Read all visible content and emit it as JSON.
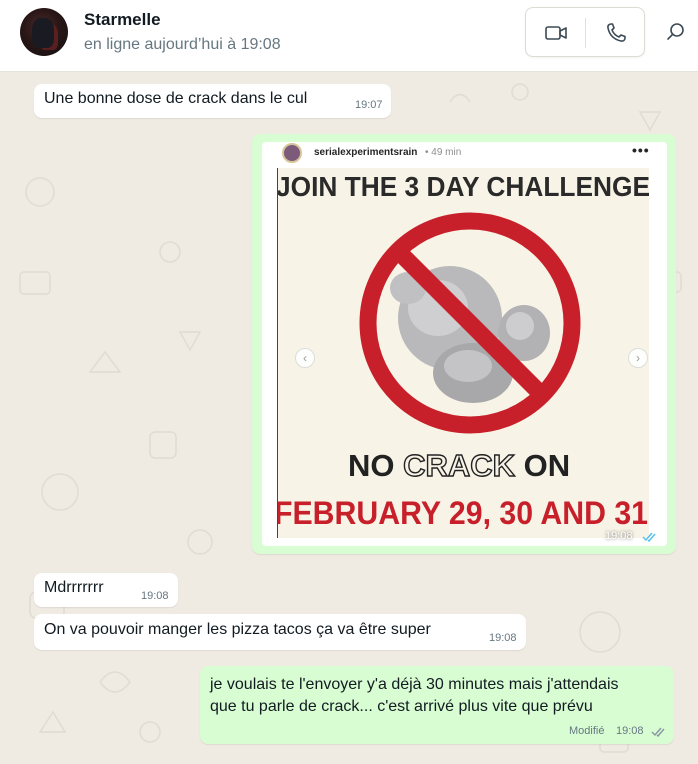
{
  "header": {
    "contact_name": "Starmelle",
    "status": "en ligne aujourd’hui à 19:08",
    "buttons": [
      "video-call",
      "voice-call",
      "search"
    ]
  },
  "messages": [
    {
      "direction": "in",
      "text": "Une bonne dose de crack dans le cul",
      "time": "19:07"
    },
    {
      "direction": "out",
      "type": "image",
      "time": "19:08",
      "read": true,
      "post": {
        "username": "serialexperimentsrain",
        "age": "• 49 min",
        "more": "•••",
        "headline": "JOIN THE 3 DAY CHALLENGE",
        "line1_prefix": "NO ",
        "line1_highlight": "CRACK",
        "line1_suffix": " ON",
        "line2": "FEBRUARY 29, 30 AND 31"
      }
    },
    {
      "direction": "in",
      "text": "Mdrrrrrrr",
      "time": "19:08"
    },
    {
      "direction": "in",
      "text": "On va pouvoir manger les pizza tacos ça va être super",
      "time": "19:08"
    },
    {
      "direction": "out",
      "lines": [
        "je voulais te l'envoyer y'a déjà 30 minutes mais j'attendais",
        "que tu parle de crack... c'est arrivé plus vite que prévu"
      ],
      "edited_label": "Modifié",
      "time": "19:08",
      "read": true
    }
  ],
  "colors": {
    "incoming": "#ffffff",
    "outgoing": "#d9fdd3",
    "background": "#efeae2",
    "read_ticks": "#53bdeb",
    "meme_red": "#c8202a"
  }
}
